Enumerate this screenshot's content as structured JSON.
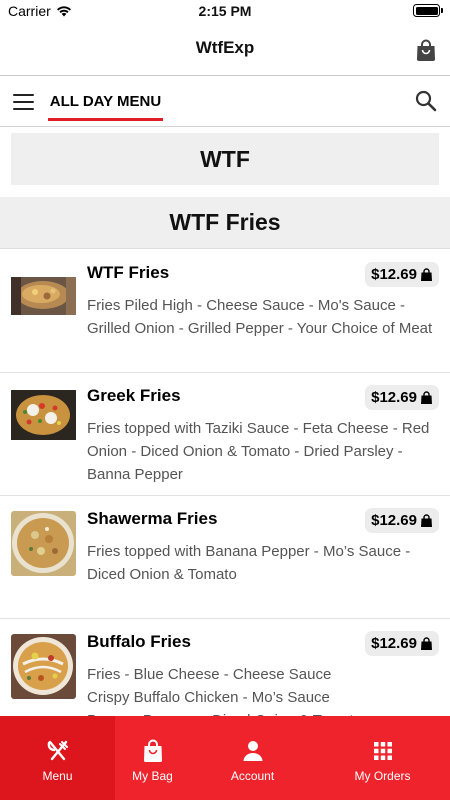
{
  "status_bar": {
    "carrier": "Carrier",
    "time": "2:15 PM"
  },
  "nav": {
    "title": "WtfExp"
  },
  "menu_tabs": {
    "active": "ALL DAY MENU"
  },
  "section": {
    "title": "WTF"
  },
  "category": {
    "title": "WTF Fries"
  },
  "items": [
    {
      "name": "WTF Fries",
      "price": "$12.69",
      "description": "Fries Piled High - Cheese Sauce - Mo's Sauce - Grilled Onion - Grilled Pepper - Your Choice of Meat"
    },
    {
      "name": "Greek Fries",
      "price": "$12.69",
      "description": "Fries topped with Taziki Sauce - Feta Cheese - Red Onion - Diced Onion & Tomato - Dried Parsley - Banna Pepper"
    },
    {
      "name": "Shawerma Fries",
      "price": "$12.69",
      "description": "Fries topped with Banana Pepper - Mo’s Sauce - Diced Onion & Tomato"
    },
    {
      "name": "Buffalo Fries",
      "price": "$12.69",
      "description": "Fries - Blue Cheese - Cheese Sauce\nCrispy Buffalo Chicken - Mo’s Sauce\nBanana Peppers - Diced Onion & Tomato"
    }
  ],
  "bottom_nav": [
    {
      "label": "Menu",
      "icon": "fork-knife-icon",
      "active": true
    },
    {
      "label": "My Bag",
      "icon": "shopping-bag-icon",
      "active": false
    },
    {
      "label": "Account",
      "icon": "person-icon",
      "active": false
    },
    {
      "label": "My Orders",
      "icon": "grid-icon",
      "active": false
    }
  ],
  "colors": {
    "accent": "#ee232b",
    "accent_active": "#dd151d",
    "section_bg": "#efefef",
    "price_bg": "#ececec",
    "description_text": "#555555"
  }
}
